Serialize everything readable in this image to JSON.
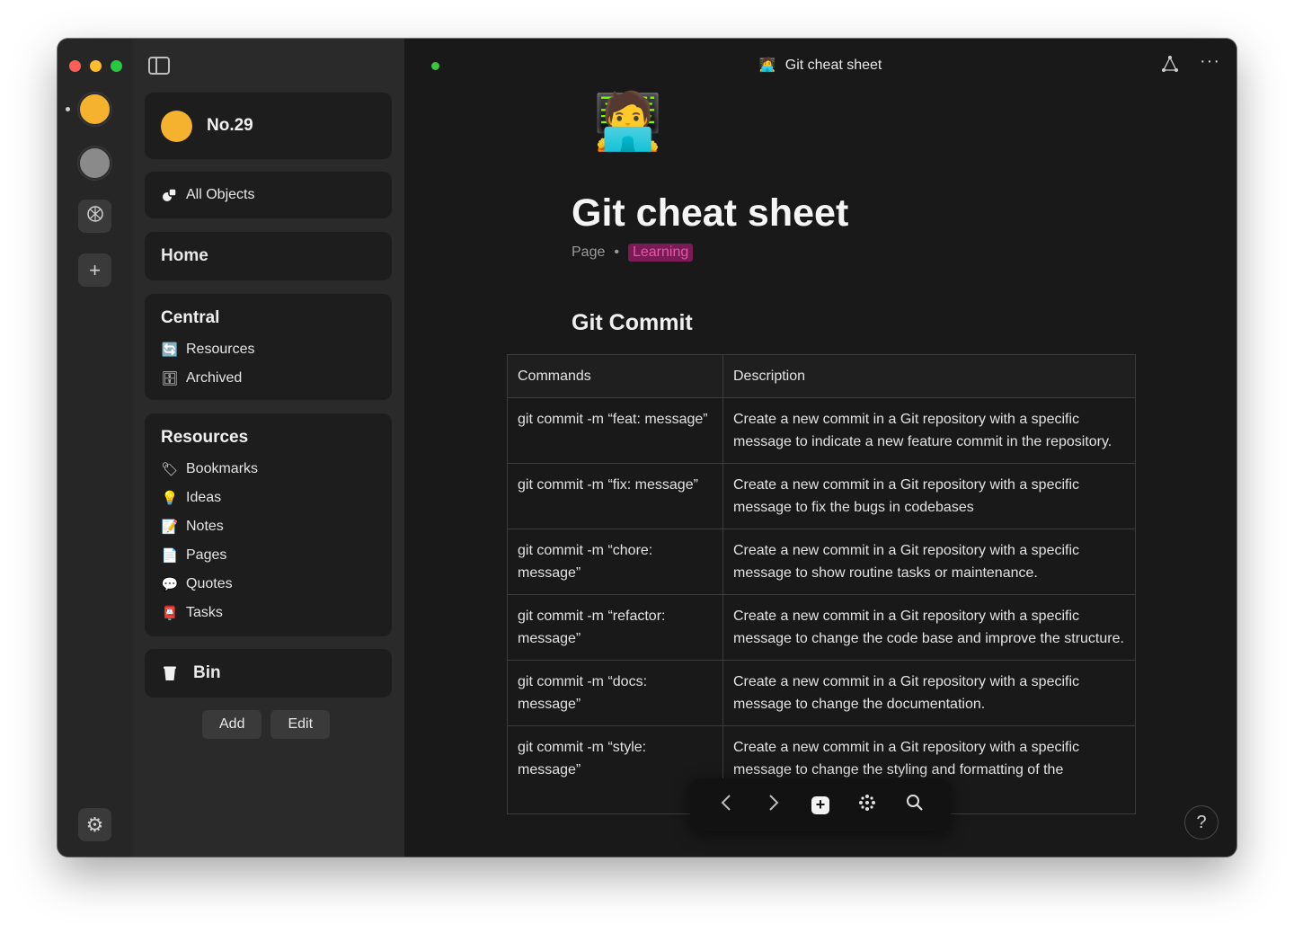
{
  "window": {
    "title": "Git cheat sheet",
    "title_emoji": "🧑‍💻"
  },
  "sidebar": {
    "space_name": "No.29",
    "all_objects_label": "All Objects",
    "home_label": "Home",
    "central": {
      "title": "Central",
      "items": [
        {
          "label": "Resources",
          "icon": "refresh-icon"
        },
        {
          "label": "Archived",
          "icon": "cabinet-icon"
        }
      ]
    },
    "resources": {
      "title": "Resources",
      "items": [
        {
          "label": "Bookmarks",
          "icon": "bookmark-icon"
        },
        {
          "label": "Ideas",
          "icon": "lightbulb-icon"
        },
        {
          "label": "Notes",
          "icon": "memo-icon"
        },
        {
          "label": "Pages",
          "icon": "page-icon"
        },
        {
          "label": "Quotes",
          "icon": "speech-icon"
        },
        {
          "label": "Tasks",
          "icon": "mailbox-icon"
        }
      ]
    },
    "bin_label": "Bin",
    "add_label": "Add",
    "edit_label": "Edit"
  },
  "page": {
    "emoji": "🧑‍💻",
    "title": "Git cheat sheet",
    "type": "Page",
    "tag": "Learning",
    "tag_color": "#7a1b56",
    "section_heading": "Git Commit"
  },
  "table": {
    "headers": [
      "Commands",
      "Description"
    ],
    "rows": [
      {
        "command": "git commit -m “feat: message”",
        "description": "Create a new commit in a Git repository with a specific message to indicate a new feature commit in the repository."
      },
      {
        "command": "git commit -m “fix: message”",
        "description": "Create a new commit in a Git repository with a specific message to fix the bugs in codebases"
      },
      {
        "command": "git commit -m “chore: message”",
        "description": "Create a new commit in a Git repository with a specific message to show routine tasks or maintenance."
      },
      {
        "command": "git commit -m “refactor: message”",
        "description": "Create a new commit in a Git repository with a specific message to change the code base and improve the structure."
      },
      {
        "command": "git commit -m “docs: message”",
        "description": "Create a new commit in a Git repository with a specific message to change the documentation."
      },
      {
        "command": "git commit -m “style: message”",
        "description": "Create a new commit in a Git repository with a specific message to change the styling and formatting of the codebase."
      }
    ]
  },
  "help_label": "?",
  "colors": {
    "accent_space": "#f4b22e",
    "sync": "#3ac53a"
  }
}
